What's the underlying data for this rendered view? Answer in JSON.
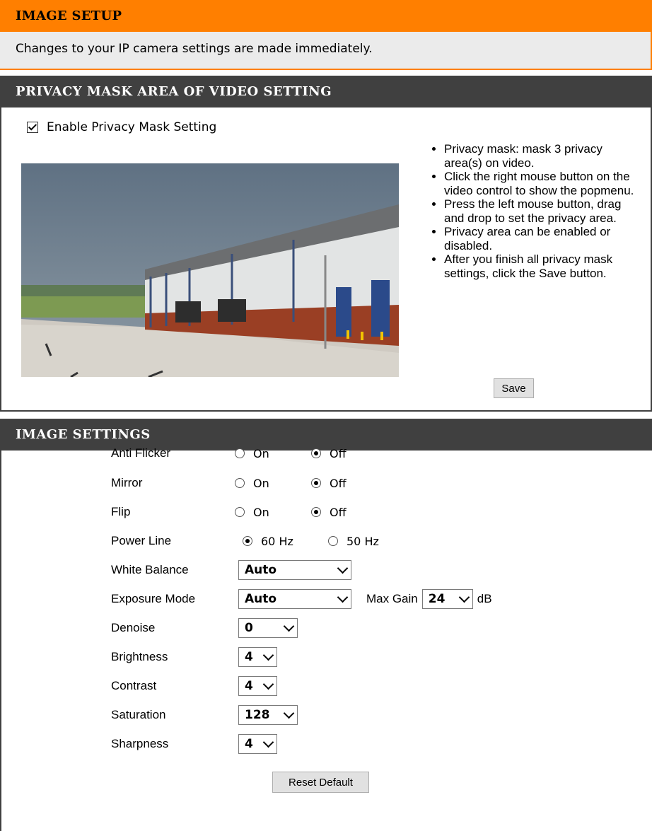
{
  "image_setup": {
    "title": "IMAGE SETUP",
    "notice": "Changes to your IP camera settings are made immediately."
  },
  "privacy": {
    "title": "PRIVACY MASK AREA OF VIDEO SETTING",
    "enable_label": "Enable Privacy Mask Setting",
    "enabled": true,
    "help": [
      "Privacy mask: mask 3 privacy area(s) on video.",
      "Click the right mouse button on the video control to show the popmenu.",
      "Press the left mouse button, drag and drop to set the privacy area.",
      "Privacy area can be enabled or disabled.",
      "After you finish all privacy mask settings, click the Save button."
    ],
    "save_label": "Save"
  },
  "image_settings": {
    "title": "IMAGE SETTINGS",
    "anti_flicker": {
      "label": "Anti Flicker",
      "on": "On",
      "off": "Off",
      "value": "off"
    },
    "mirror": {
      "label": "Mirror",
      "on": "On",
      "off": "Off",
      "value": "off"
    },
    "flip": {
      "label": "Flip",
      "on": "On",
      "off": "Off",
      "value": "off"
    },
    "power_line": {
      "label": "Power Line",
      "opt1": "60 Hz",
      "opt2": "50 Hz",
      "value": "60 Hz"
    },
    "white_balance": {
      "label": "White Balance",
      "value": "Auto"
    },
    "exposure_mode": {
      "label": "Exposure Mode",
      "value": "Auto",
      "max_gain_label": "Max Gain",
      "max_gain_value": "24",
      "unit": "dB"
    },
    "denoise": {
      "label": "Denoise",
      "value": "0"
    },
    "brightness": {
      "label": "Brightness",
      "value": "4"
    },
    "contrast": {
      "label": "Contrast",
      "value": "4"
    },
    "saturation": {
      "label": "Saturation",
      "value": "128"
    },
    "sharpness": {
      "label": "Sharpness",
      "value": "4"
    },
    "reset_label": "Reset Default"
  },
  "colors": {
    "accent": "#ff7f00",
    "header_dark": "#404040",
    "notice_bg": "#ebebeb"
  }
}
